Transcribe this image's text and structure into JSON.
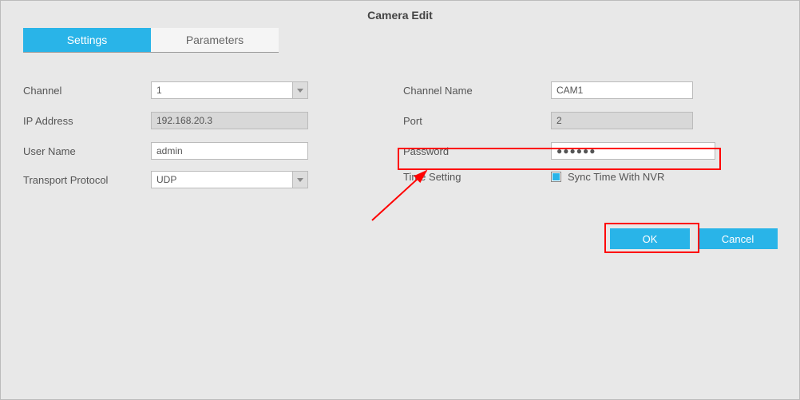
{
  "title": "Camera Edit",
  "tabs": {
    "settings": "Settings",
    "parameters": "Parameters"
  },
  "labels": {
    "channel": "Channel",
    "channel_name": "Channel Name",
    "ip_address": "IP Address",
    "port": "Port",
    "user_name": "User Name",
    "password": "Password",
    "transport_protocol": "Transport Protocol",
    "time_setting": "Time Setting",
    "sync_time": "Sync Time With NVR"
  },
  "values": {
    "channel": "1",
    "channel_name": "CAM1",
    "ip_address": "192.168.20.3",
    "port": "2",
    "user_name": "admin",
    "password": "●●●●●●",
    "transport_protocol": "UDP"
  },
  "buttons": {
    "ok": "OK",
    "cancel": "Cancel"
  }
}
